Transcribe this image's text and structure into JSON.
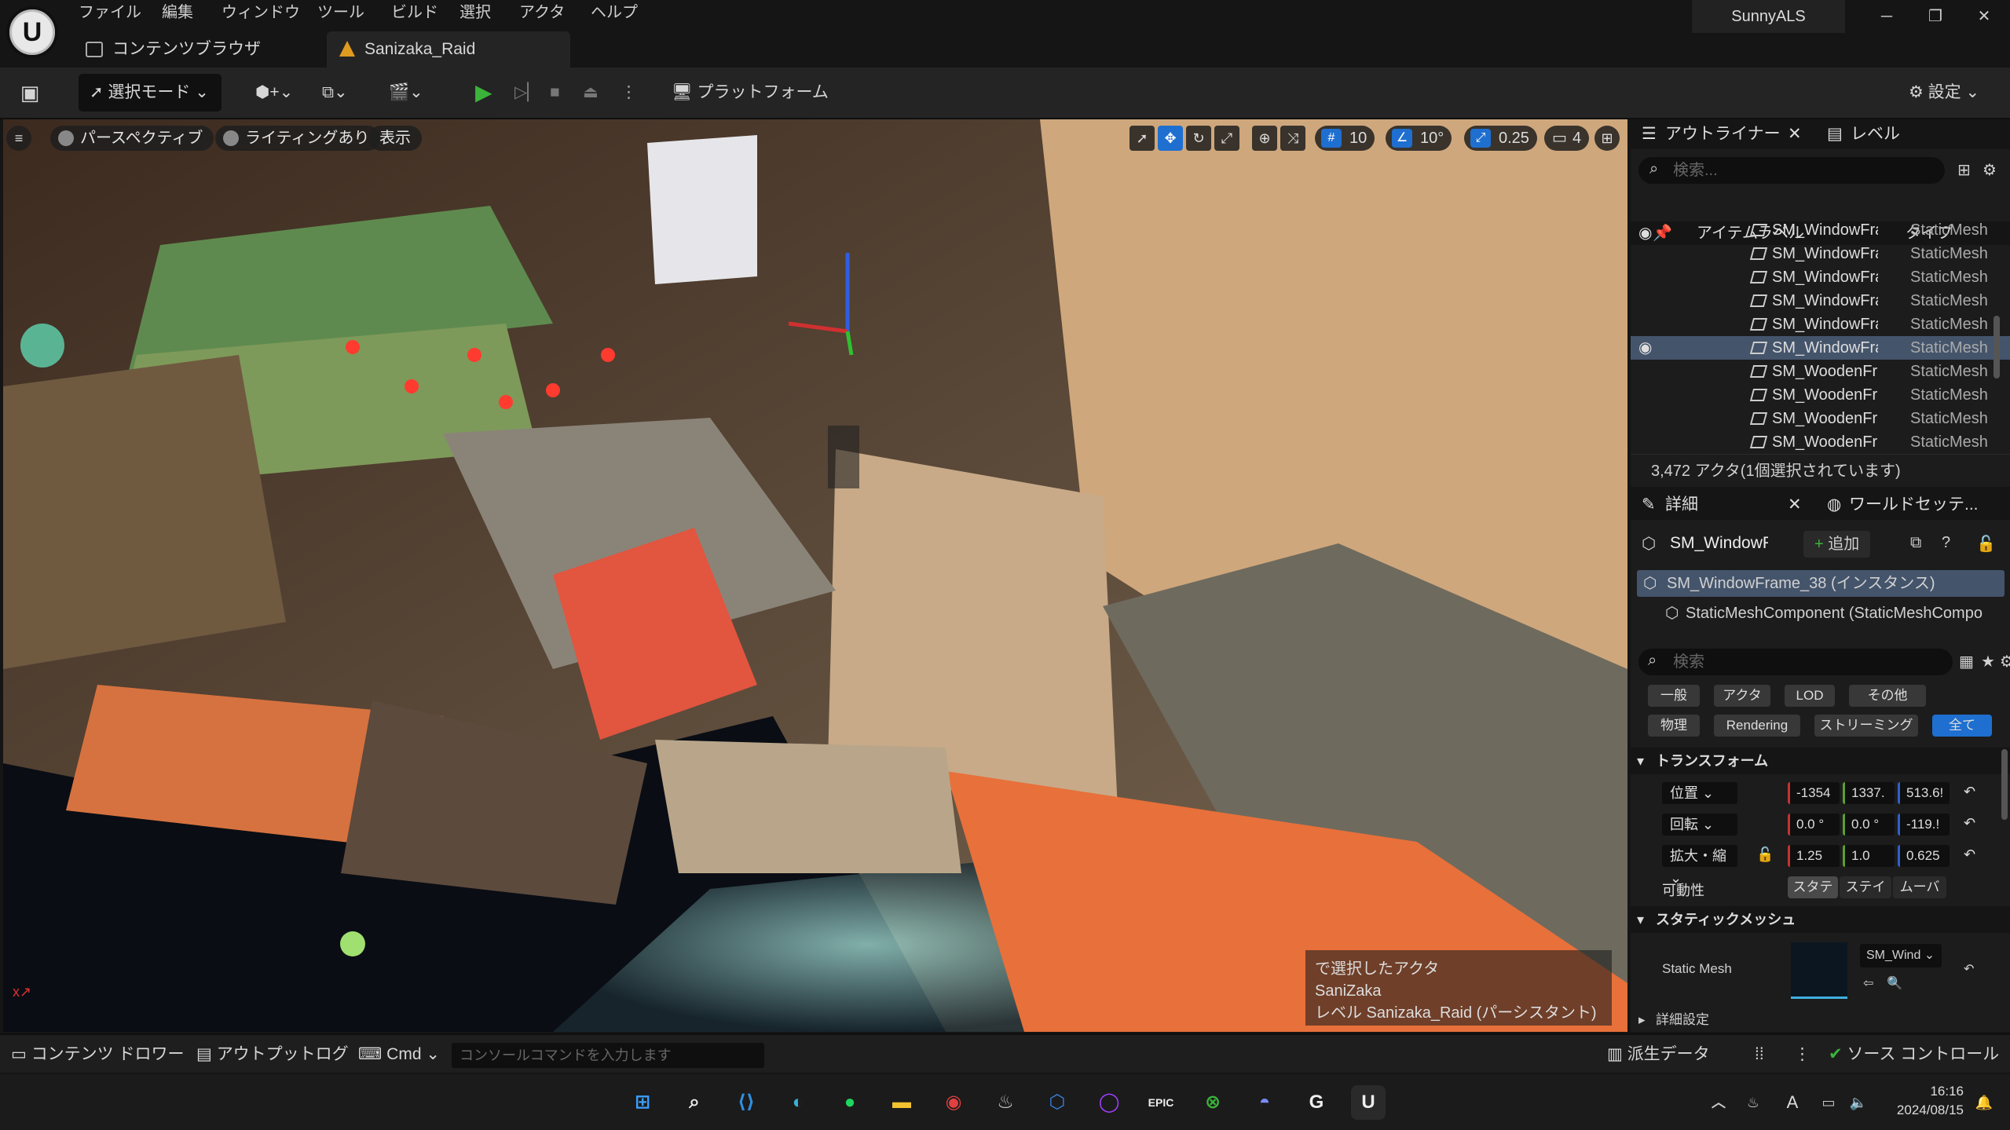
{
  "menu": [
    "ファイル",
    "編集",
    "ウィンドウ",
    "ツール",
    "ビルド",
    "選択",
    "アクタ",
    "ヘルプ"
  ],
  "tabs": {
    "content_browser": "コンテンツブラウザ",
    "level": "Sanizaka_Raid"
  },
  "project_name": "SunnyALS",
  "toolbar": {
    "select_mode": "選択モード",
    "platform": "プラットフォーム",
    "settings": "設定"
  },
  "viewport": {
    "perspective": "パースペクティブ",
    "lighting": "ライティングあり",
    "show": "表示",
    "grid_snap": "10",
    "rot_snap": "10°",
    "scale_snap": "0.25",
    "camera_speed": "4",
    "overlay_line1": "で選択したアクタ",
    "overlay_line2": "SaniZaka",
    "overlay_line3": "レベル  Sanizaka_Raid (パーシスタント)"
  },
  "outliner": {
    "title": "アウトライナー",
    "levels_tab": "レベル",
    "search_placeholder": "検索...",
    "col_label": "アイテムラベル",
    "col_type": "タイプ",
    "rows": [
      {
        "name": "SM_WindowFra",
        "type": "StaticMesh"
      },
      {
        "name": "SM_WindowFra",
        "type": "StaticMesh"
      },
      {
        "name": "SM_WindowFra",
        "type": "StaticMesh"
      },
      {
        "name": "SM_WindowFra",
        "type": "StaticMesh"
      },
      {
        "name": "SM_WindowFra",
        "type": "StaticMesh"
      },
      {
        "name": "SM_WindowFra",
        "type": "StaticMesh"
      },
      {
        "name": "SM_WoodenFra",
        "type": "StaticMesh"
      },
      {
        "name": "SM_WoodenFra",
        "type": "StaticMesh"
      },
      {
        "name": "SM_WoodenFra",
        "type": "StaticMesh"
      },
      {
        "name": "SM_WoodenFra",
        "type": "StaticMesh"
      }
    ],
    "count": "3,472 アクタ(1個選択されています)"
  },
  "details": {
    "title": "詳細",
    "world_settings": "ワールドセッテ...",
    "actor_name": "SM_WindowFra",
    "add": "追加",
    "instance": "SM_WindowFrame_38 (インスタンス)",
    "component": "StaticMeshComponent (StaticMeshCompo",
    "search_placeholder": "検索",
    "filters_row1": [
      "一般",
      "アクタ",
      "LOD",
      "その他"
    ],
    "filters_row2": [
      "物理",
      "Rendering",
      "ストリーミング",
      "全て"
    ],
    "transform_header": "トランスフォーム",
    "location": {
      "label": "位置",
      "x": "-1354",
      "y": "1337.",
      "z": "513.6!"
    },
    "rotation": {
      "label": "回転",
      "x": "0.0 °",
      "y": "0.0 °",
      "z": "-119.!"
    },
    "scale": {
      "label": "拡大・縮",
      "x": "1.25",
      "y": "1.0",
      "z": "0.625"
    },
    "mobility": {
      "label": "可動性",
      "opts": [
        "スタテ",
        "ステイ",
        "ムーバ"
      ]
    },
    "static_mesh_header": "スタティックメッシュ",
    "static_mesh_label": "Static Mesh",
    "static_mesh_value": "SM_Wind",
    "advanced": "詳細設定"
  },
  "statusbar": {
    "content_drawer": "コンテンツ ドロワー",
    "output_log": "アウトプットログ",
    "cmd": "Cmd",
    "cmd_placeholder": "コンソールコマンドを入力します",
    "derived_data": "派生データ",
    "source_control": "ソース コントロール"
  },
  "taskbar": {
    "time": "16:16",
    "date": "2024/08/15",
    "ime": "A"
  }
}
